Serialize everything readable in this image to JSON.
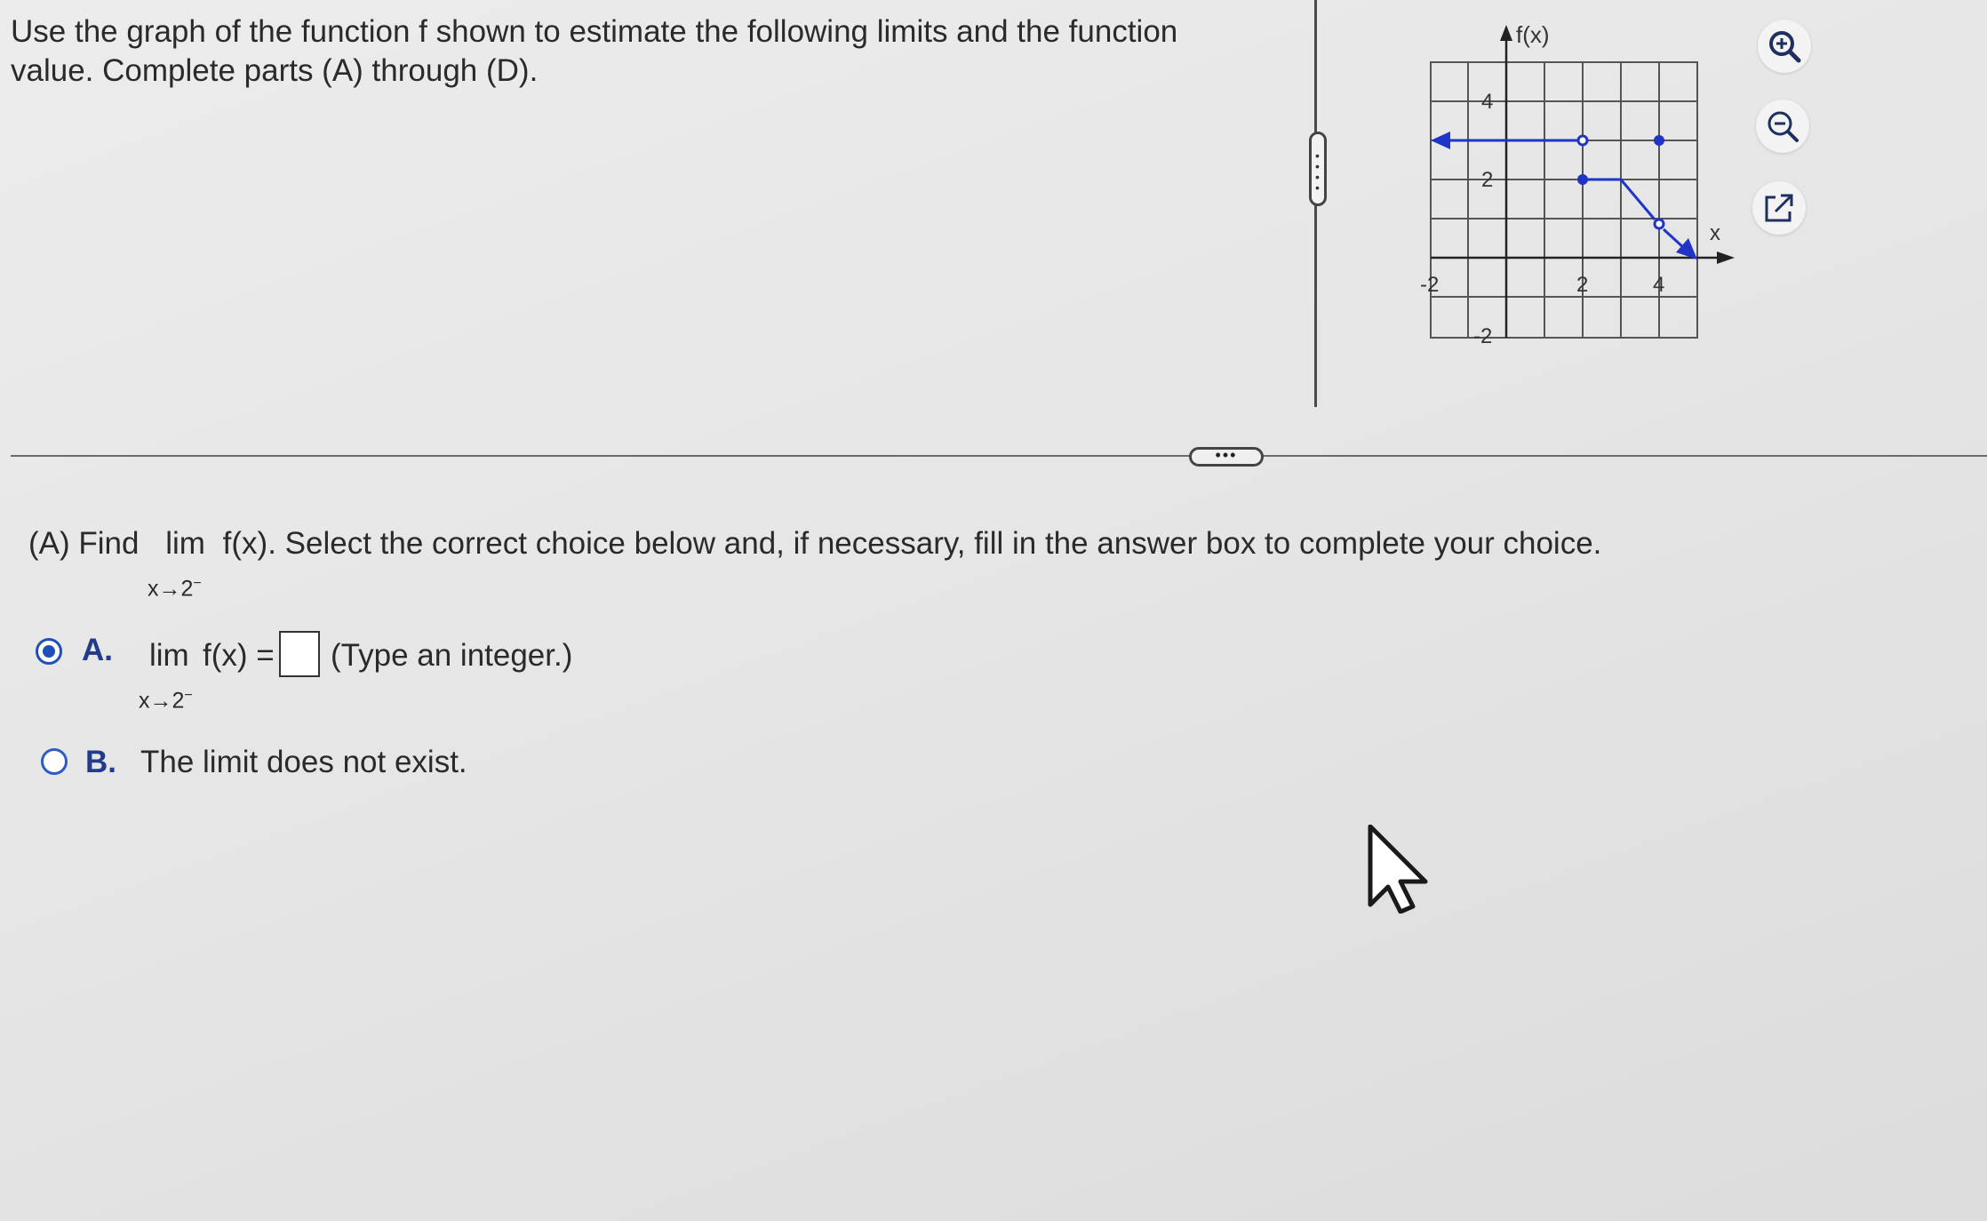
{
  "question": {
    "line1": "Use the graph of the function f shown to estimate the following limits and the function",
    "line2": "value. Complete parts (A) through (D)."
  },
  "graph": {
    "y_axis_label": "f(x)",
    "x_axis_label": "x",
    "tick_labels": {
      "x_neg2": "-2",
      "x_2": "2",
      "x_4": "4",
      "y_4": "4",
      "y_2": "2",
      "y_neg2": "-2"
    },
    "line_color": "#1f34c8"
  },
  "toolbar": {
    "zoom_in": "zoom-in-icon",
    "zoom_out": "zoom-out-icon",
    "popout": "external-link-icon"
  },
  "part_a": {
    "prompt_prefix": "(A) Find",
    "lim": "lim",
    "fx": "f(x). Select the correct choice below and, if necessary, fill in the answer box to complete your choice.",
    "sub": "x→2",
    "sup": "−"
  },
  "choices": [
    {
      "letter": "A.",
      "lim": "lim",
      "expr": "f(x) =",
      "sub": "x→2",
      "sup": "−",
      "hint": "(Type an integer.)",
      "selected": true,
      "answer": ""
    },
    {
      "letter": "B.",
      "text": "The limit does not exist.",
      "selected": false
    }
  ],
  "colors": {
    "accent": "#1f4fb8",
    "curve": "#1f34c8"
  }
}
